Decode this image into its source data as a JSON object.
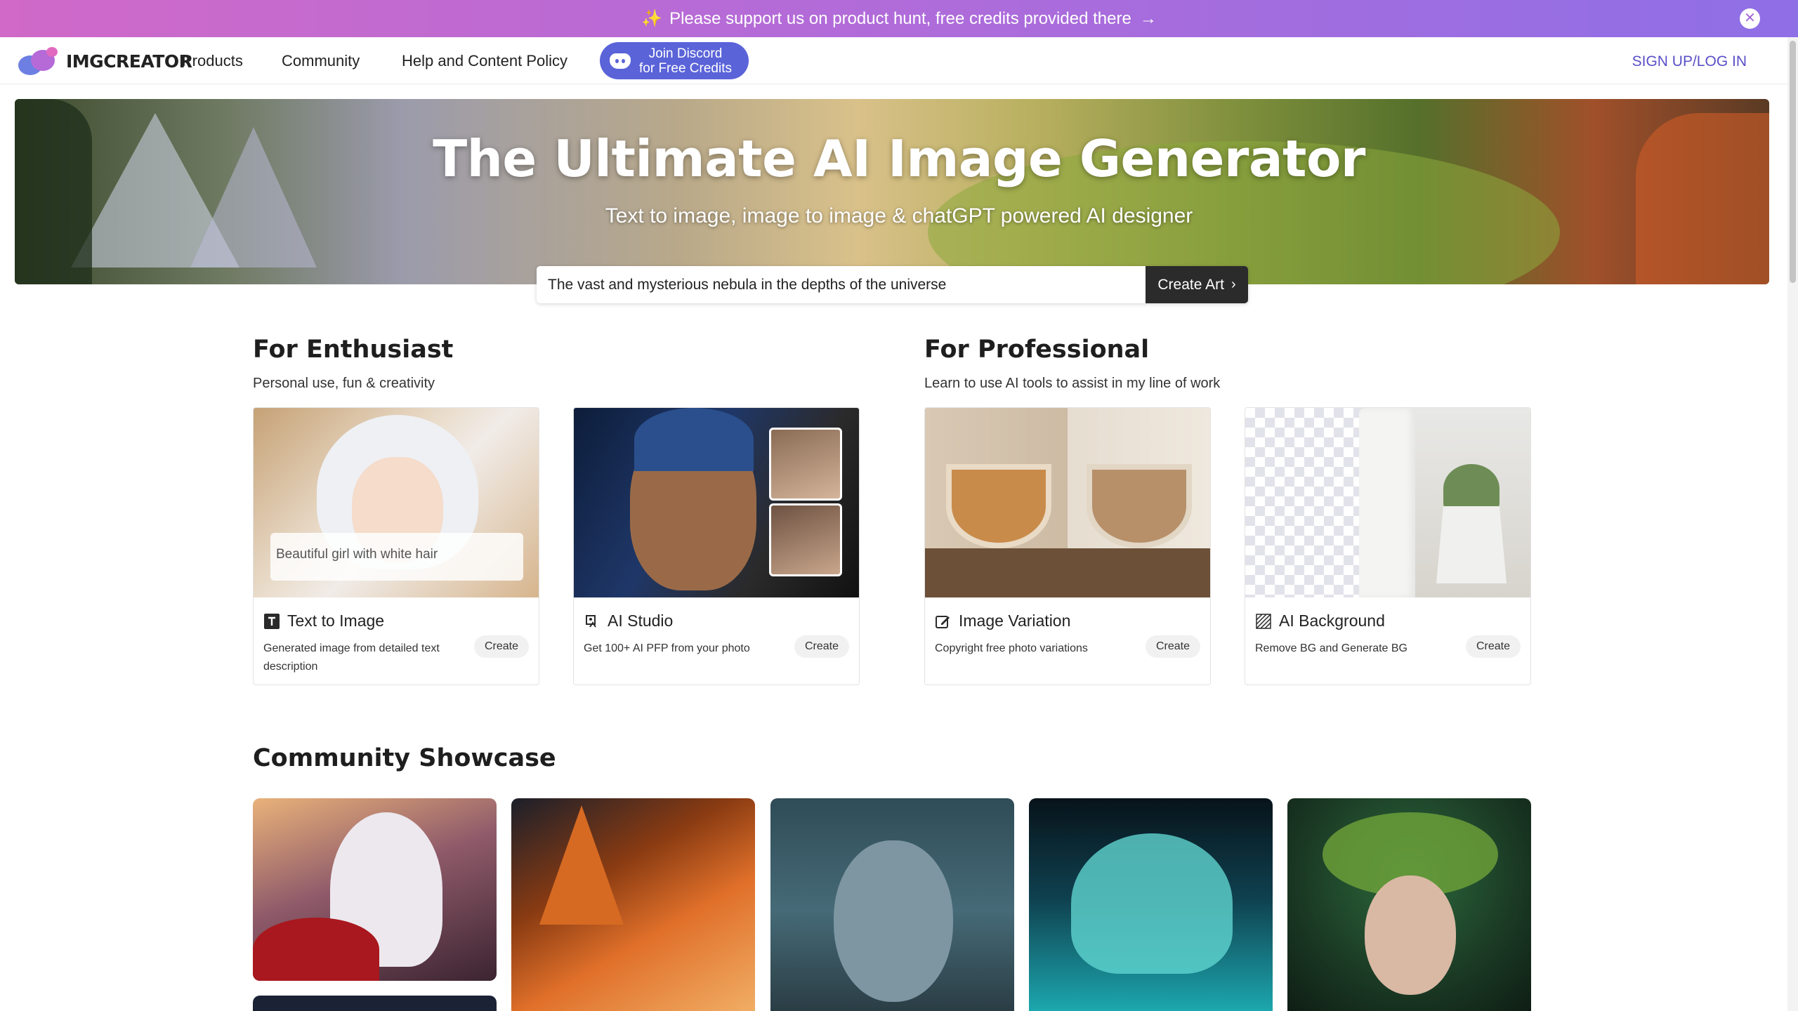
{
  "promo": {
    "text": "Please support us on product hunt, free credits provided there",
    "sparkle": "✨",
    "arrow": "→"
  },
  "nav": {
    "logo_text": "IMGCREATOR",
    "links": [
      "Products",
      "Community",
      "Help and Content Policy"
    ],
    "discord_line1": "Join Discord",
    "discord_line2": "for Free Credits",
    "auth": "SIGN UP/LOG IN"
  },
  "hero": {
    "title": "The Ultimate AI Image Generator",
    "subtitle": "Text to image, image to image & chatGPT powered AI designer"
  },
  "search": {
    "value": "The vast and mysterious nebula in the depths of the universe",
    "button": "Create Art"
  },
  "enthusiast": {
    "title": "For Enthusiast",
    "subtitle": "Personal use, fun & creativity",
    "cards": [
      {
        "title": "Text to Image",
        "desc": "Generated image from detailed text description",
        "button": "Create",
        "icon": "text-icon",
        "caption": "Beautiful girl with white hair"
      },
      {
        "title": "AI Studio",
        "desc": "Get 100+ AI PFP from your photo",
        "button": "Create",
        "icon": "studio-icon"
      }
    ]
  },
  "professional": {
    "title": "For Professional",
    "subtitle": "Learn to use AI tools to assist in my line of work",
    "cards": [
      {
        "title": "Image Variation",
        "desc": "Copyright free photo variations",
        "button": "Create",
        "icon": "edit-icon"
      },
      {
        "title": "AI Background",
        "desc": "Remove BG and Generate BG",
        "button": "Create",
        "icon": "background-icon"
      }
    ]
  },
  "showcase": {
    "title": "Community Showcase"
  },
  "colors": {
    "accent": "#5a50c8",
    "discord": "#5a63d8",
    "banner_start": "#d069c8",
    "banner_end": "#8f6fe6"
  }
}
